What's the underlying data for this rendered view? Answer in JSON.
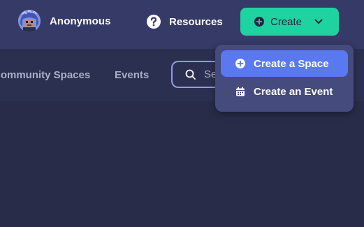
{
  "header": {
    "profile_name": "Anonymous",
    "resources_label": "Resources",
    "create_label": "Create"
  },
  "subnav": {
    "items": [
      {
        "label": "Community Spaces"
      },
      {
        "label": "Events"
      }
    ],
    "search_placeholder": "Search"
  },
  "dropdown": {
    "items": [
      {
        "label": "Create a Space",
        "icon": "plus-circle-icon",
        "active": true
      },
      {
        "label": "Create an Event",
        "icon": "calendar-icon",
        "active": false
      }
    ]
  },
  "colors": {
    "accent_green": "#1ed3a0",
    "accent_blue": "#5a78f0",
    "topbar": "#353a66",
    "background": "#282c48"
  }
}
